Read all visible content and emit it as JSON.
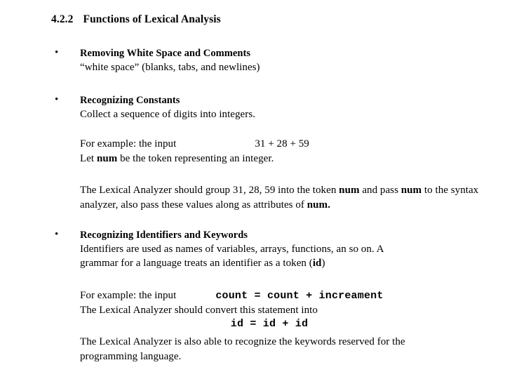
{
  "slide": {
    "background_color": "#ffffff",
    "text_color": "#000000",
    "heading": {
      "number": "4.2.2",
      "title": "Functions of Lexical Analysis"
    },
    "bullet_marker": "•",
    "bullets": [
      {
        "title": "Removing White Space and Comments",
        "subtitle": "“white space” (blanks, tabs, and newlines)"
      },
      {
        "title": "Recognizing Constants",
        "subtitle": "Collect a sequence of digits into integers."
      },
      {
        "title": "Recognizing Identifiers and Keywords",
        "subtitle_line1": "Identifiers are used as names of variables, arrays, functions, an so on. A",
        "subtitle_line2_pre": "grammar for a language treats an identifier as a token (",
        "subtitle_line2_bold": "id",
        "subtitle_line2_post": ")"
      }
    ],
    "constants_example": {
      "line1_label": "For example: the input",
      "line1_code": "31 + 28 + 59",
      "line2_pre": "Let ",
      "line2_bold": "num",
      "line2_post": " be the token representing an integer."
    },
    "constants_note": {
      "seg1": "The Lexical Analyzer should group 31, 28, 59 into the token ",
      "bold1": "num",
      "seg2": " and pass ",
      "bold2": "num",
      "seg3": " to the syntax analyzer, also pass these values along as attributes of ",
      "bold3": "num."
    },
    "identifiers_example": {
      "line1_label": "For example: the input",
      "line1_code": "count = count + increament",
      "line2": "The Lexical Analyzer should convert this statement into",
      "line3_code": "id = id + id",
      "line4": "The Lexical Analyzer is also able to recognize the keywords reserved for the",
      "line5": "programming language."
    }
  }
}
